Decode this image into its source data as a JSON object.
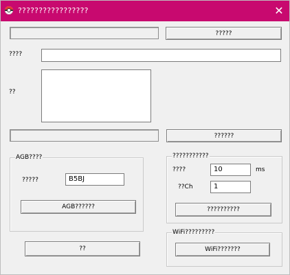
{
  "window": {
    "title": "?????????????????"
  },
  "top_buttons": {
    "right1": "?????",
    "right2": "??????"
  },
  "labels": {
    "row1": "????",
    "row2": "??"
  },
  "agb": {
    "title": "AGB????",
    "field_label": "?????",
    "field_value": "B5BJ",
    "button": "AGB??????"
  },
  "right_panel": {
    "title": "???????????",
    "row1_label": "????",
    "row1_value": "10",
    "row1_unit": "ms",
    "row2_label": "??Ch",
    "row2_value": "1",
    "button": "??????????"
  },
  "wifi": {
    "title": "WiFi?????????",
    "button": "WiFi???????"
  },
  "bottom_button": "??"
}
